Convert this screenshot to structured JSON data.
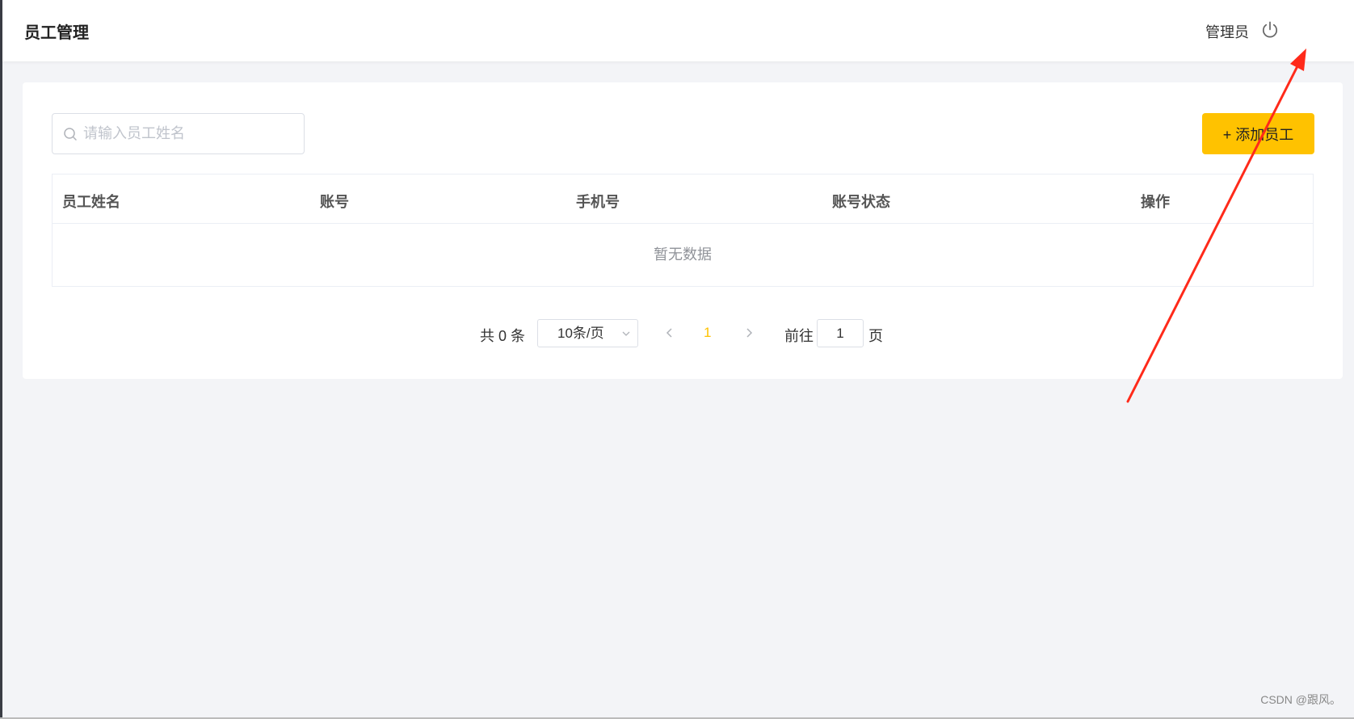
{
  "header": {
    "title": "员工管理",
    "user_name": "管理员",
    "logout_icon": "power-icon"
  },
  "toolbar": {
    "search_placeholder": "请输入员工姓名",
    "search_value": "",
    "search_icon": "search-icon",
    "add_label": "+ 添加员工",
    "add_color": "#ffc200"
  },
  "table": {
    "columns": [
      "员工姓名",
      "账号",
      "手机号",
      "账号状态",
      "操作"
    ],
    "rows": [],
    "empty_text": "暂无数据"
  },
  "pagination": {
    "total_label": "共 0 条",
    "page_size_label": "10条/页",
    "current_page": "1",
    "goto_label": "前往",
    "goto_value": "1",
    "page_suffix": "页",
    "prev_icon": "chevron-left-icon",
    "next_icon": "chevron-right-icon",
    "active_color": "#ffc200"
  },
  "annotation": {
    "arrow_color": "#ff2a1a"
  },
  "watermark": "CSDN @跟风。"
}
